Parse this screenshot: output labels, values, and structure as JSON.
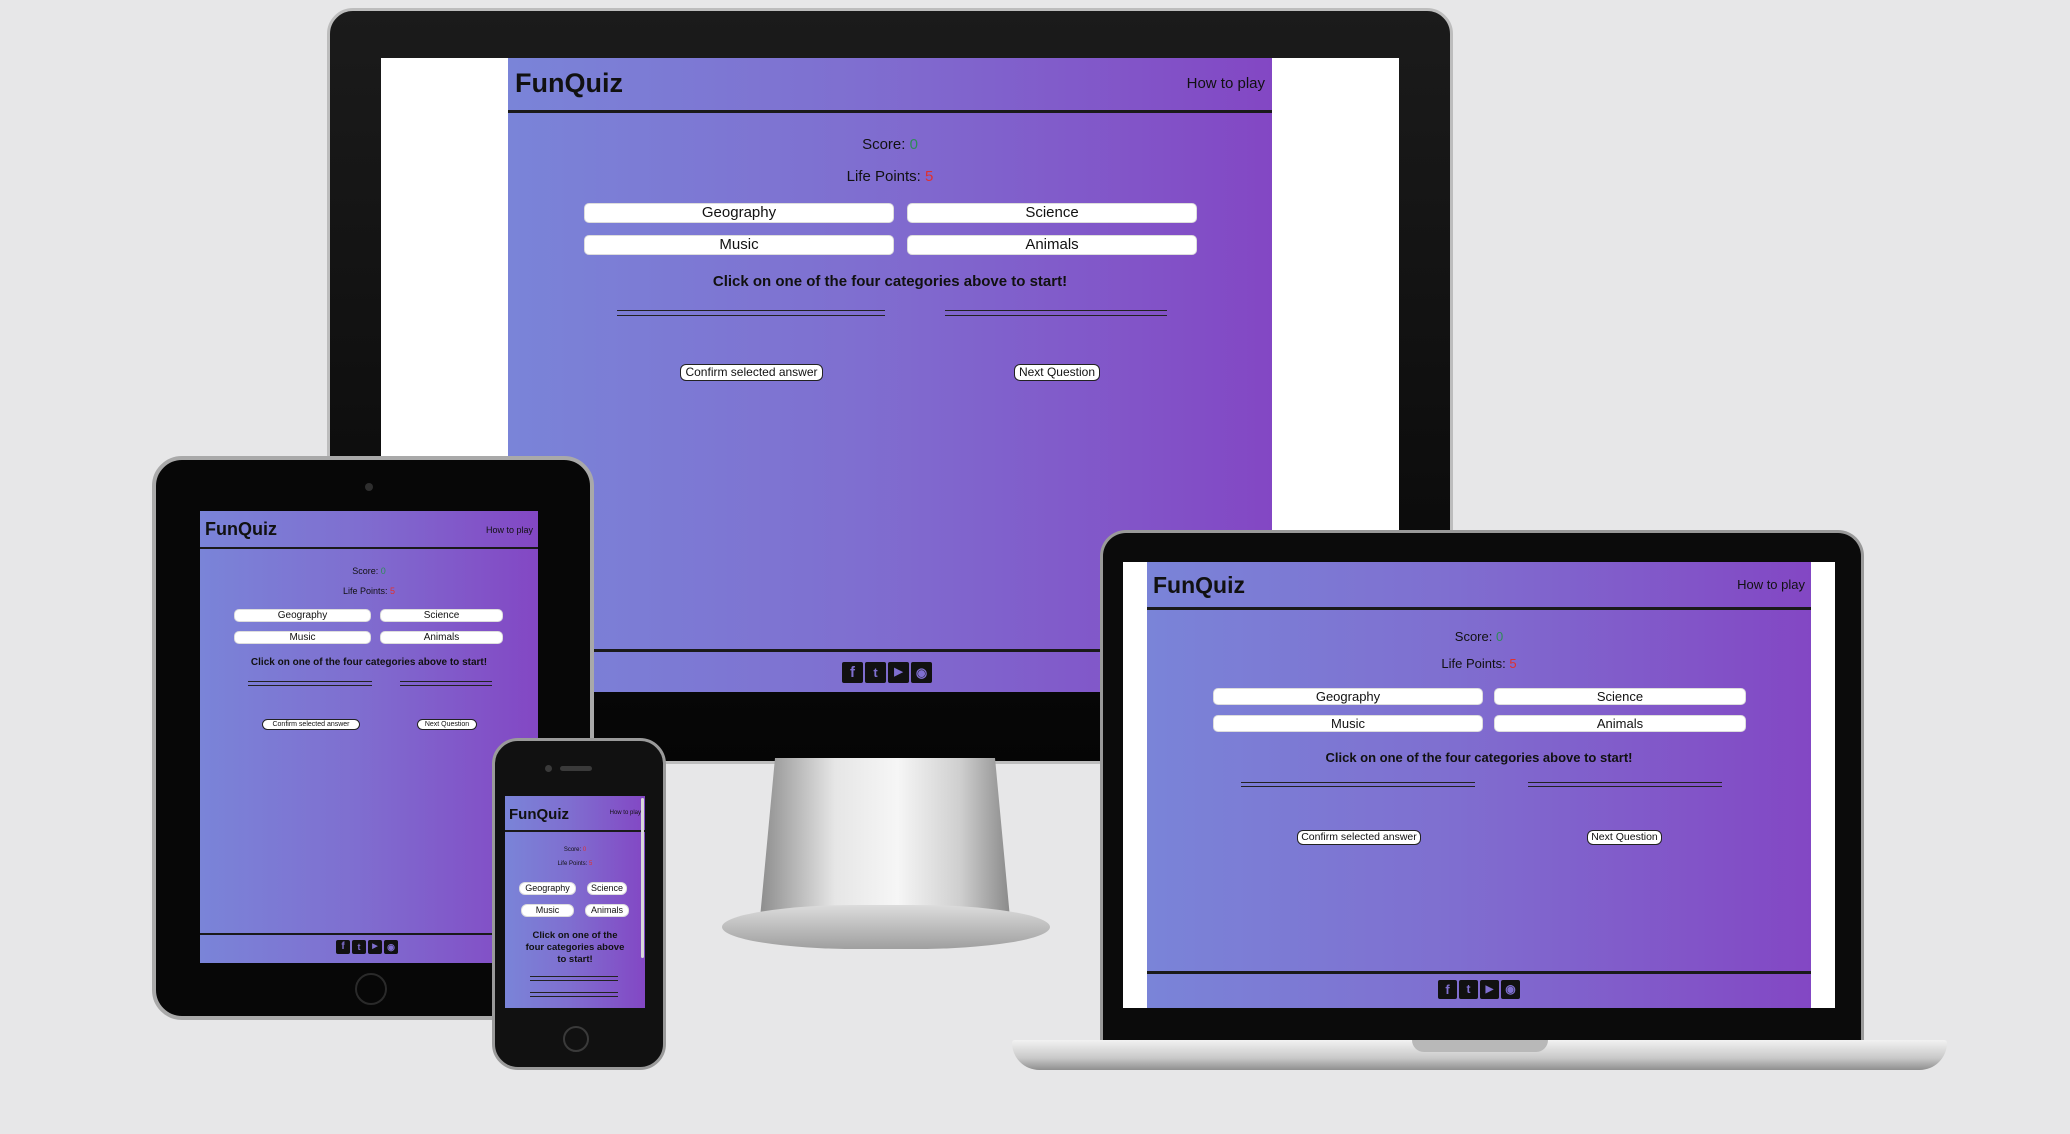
{
  "app": {
    "title": "FunQuiz",
    "nav_link": "How to play",
    "score_label": "Score: ",
    "score_value": "0",
    "life_label": "Life Points: ",
    "life_value": "5",
    "categories": [
      "Geography",
      "Science",
      "Music",
      "Animals"
    ],
    "instruction": "Click on one of the four categories above to start!",
    "confirm_button": "Confirm selected answer",
    "next_button": "Next Question",
    "social_icons": [
      "facebook-icon",
      "twitter-icon",
      "youtube-icon",
      "reddit-icon"
    ]
  },
  "colors": {
    "gradient_start": "#7a84d8",
    "gradient_end": "#8347c4",
    "score": "#2e8b57",
    "life": "#e0302f",
    "background": "#e7e7e8"
  }
}
